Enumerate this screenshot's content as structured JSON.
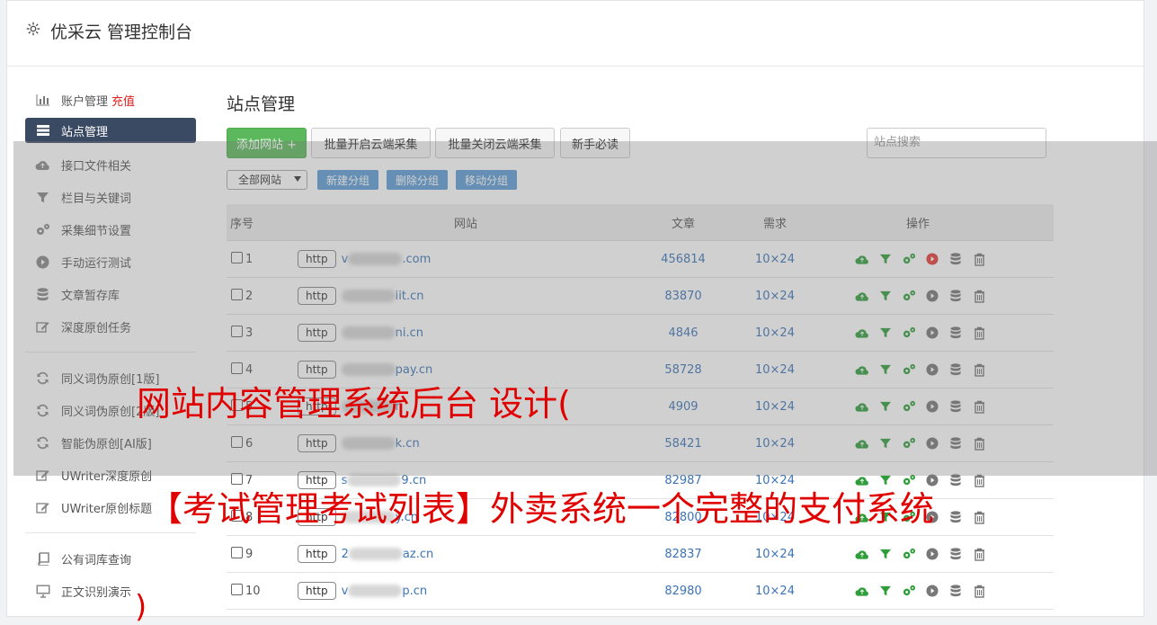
{
  "header": {
    "title": "优采云 管理控制台"
  },
  "sidebar": {
    "group1": [
      {
        "label": "账户管理",
        "extra": "充值",
        "icon": "bar-chart-icon"
      },
      {
        "label": "站点管理",
        "icon": "server-icon",
        "active": true
      },
      {
        "label": "接口文件相关",
        "icon": "cloud-upload-icon"
      },
      {
        "label": "栏目与关键词",
        "icon": "filter-icon"
      },
      {
        "label": "采集细节设置",
        "icon": "gears-icon"
      },
      {
        "label": "手动运行测试",
        "icon": "play-circle-icon"
      },
      {
        "label": "文章暂存库",
        "icon": "database-icon"
      },
      {
        "label": "深度原创任务",
        "icon": "edit-icon"
      }
    ],
    "group2": [
      {
        "label": "同义词伪原创[1版]",
        "icon": "refresh-icon"
      },
      {
        "label": "同义词伪原创[2版]",
        "icon": "refresh-icon"
      },
      {
        "label": "智能伪原创[AI版]",
        "icon": "refresh-icon"
      },
      {
        "label": "UWriter深度原创",
        "icon": "edit-icon"
      },
      {
        "label": "UWriter原创标题",
        "icon": "edit-icon"
      }
    ],
    "group3": [
      {
        "label": "公有词库查询",
        "icon": "book-icon"
      },
      {
        "label": "正文识别演示",
        "icon": "monitor-icon"
      }
    ]
  },
  "main": {
    "title": "站点管理",
    "buttons": {
      "add": "添加网站 +",
      "batch_on": "批量开启云端采集",
      "batch_off": "批量关闭云端采集",
      "guide": "新手必读"
    },
    "search_placeholder": "站点搜索",
    "group_select": "全部网站",
    "group_buttons": {
      "new": "新建分组",
      "delete": "删除分组",
      "move": "移动分组"
    },
    "columns": {
      "index": "序号",
      "site": "网站",
      "articles": "文章",
      "demand": "需求",
      "ops": "操作"
    },
    "rows": [
      {
        "index": "1",
        "prefix": "http",
        "site_start": "v",
        "site_end": ".com",
        "articles": "456814",
        "demand": "10×24",
        "active": true
      },
      {
        "index": "2",
        "prefix": "http",
        "site_start": "",
        "site_end": "iit.cn",
        "articles": "83870",
        "demand": "10×24",
        "active": false
      },
      {
        "index": "3",
        "prefix": "http",
        "site_start": "",
        "site_end": "ni.cn",
        "articles": "4846",
        "demand": "10×24",
        "active": false
      },
      {
        "index": "4",
        "prefix": "http",
        "site_start": "",
        "site_end": "pay.cn",
        "articles": "58728",
        "demand": "10×24",
        "active": false
      },
      {
        "index": "5",
        "prefix": "http",
        "site_start": "",
        "site_end": "n",
        "articles": "4909",
        "demand": "10×24",
        "active": false
      },
      {
        "index": "6",
        "prefix": "http",
        "site_start": "",
        "site_end": "k.cn",
        "articles": "58421",
        "demand": "10×24",
        "active": false
      },
      {
        "index": "7",
        "prefix": "http",
        "site_start": "s",
        "site_end": "9.cn",
        "articles": "82987",
        "demand": "10×24",
        "active": false
      },
      {
        "index": "8",
        "prefix": "http",
        "site_start": "",
        "site_end": "y.cn",
        "articles": "82800",
        "demand": "10×24",
        "active": false
      },
      {
        "index": "9",
        "prefix": "http",
        "site_start": "2",
        "site_end": "az.cn",
        "articles": "82837",
        "demand": "10×24",
        "active": false
      },
      {
        "index": "10",
        "prefix": "http",
        "site_start": "v",
        "site_end": "p.cn",
        "articles": "82980",
        "demand": "10×24",
        "active": false
      }
    ]
  },
  "overlay": {
    "line1": "网站内容管理系统后台 设计(",
    "line2": "【考试管理考试列表】外卖系统一个完整的支付系统",
    "line3": ")"
  },
  "colors": {
    "accent_green": "#5cb85c",
    "nav_active": "#3b4a63",
    "link_blue": "#3b73b5",
    "watermark_red": "#e00000",
    "play_red": "#e53935"
  }
}
